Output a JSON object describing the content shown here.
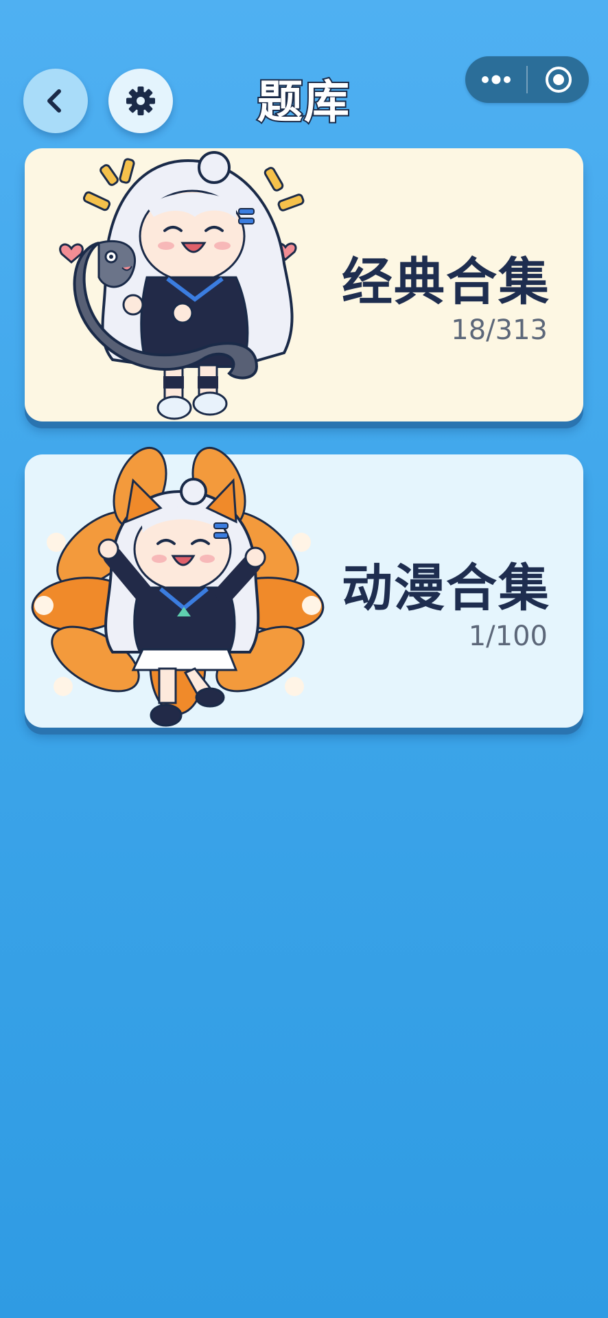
{
  "header": {
    "title": "题库"
  },
  "banks": [
    {
      "title": "经典合集",
      "progress": "18/313",
      "background": "#fdf7e3"
    },
    {
      "title": "动漫合集",
      "progress": "1/100",
      "background": "#e5f5fd"
    }
  ],
  "colors": {
    "background_top": "#4fb0f2",
    "background_bottom": "#2f9be3",
    "title_text": "#1e2d4f",
    "progress_text": "#5c6779",
    "capsule": "#2b6e99"
  },
  "icons": {
    "back": "chevron-left-icon",
    "settings": "gear-icon",
    "more": "more-dots-icon",
    "close": "target-circle-icon"
  }
}
